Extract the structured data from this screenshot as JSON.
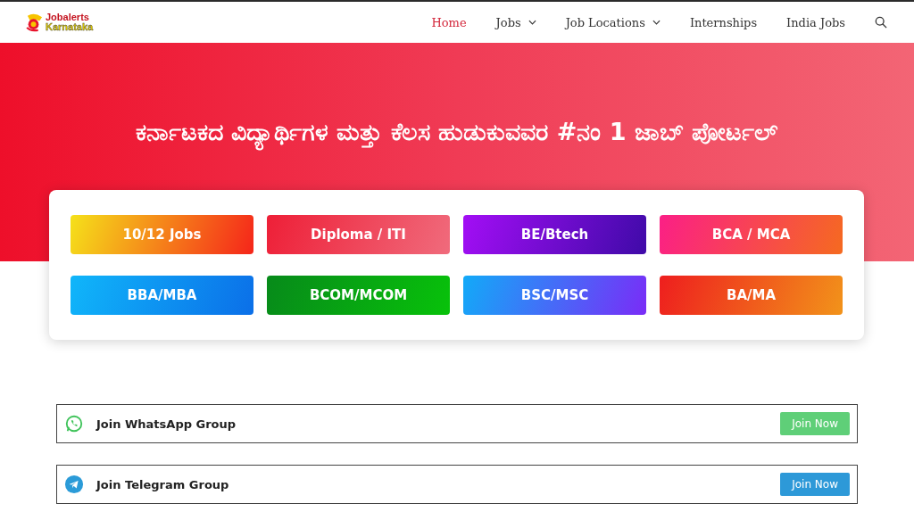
{
  "logo": {
    "line_1": "Jobalerts",
    "line_2": "Karnataka"
  },
  "nav": [
    {
      "label": "Home",
      "selected": true,
      "dropdown": false
    },
    {
      "label": "Jobs",
      "selected": false,
      "dropdown": true
    },
    {
      "label": "Job Locations",
      "selected": false,
      "dropdown": true
    },
    {
      "label": "Internships",
      "selected": false,
      "dropdown": false
    },
    {
      "label": "India Jobs",
      "selected": false,
      "dropdown": false
    }
  ],
  "hero": {
    "title": "ಕರ್ನಾಟಕದ ವಿದ್ಯಾರ್ಥಿಗಳ ಮತ್ತು ಕೆಲಸ ಹುಡುಕುವವರ #ನಂ 1 ಜಾಬ್ ಪೋರ್ಟಲ್"
  },
  "categories": [
    {
      "label": "10/12 Jobs"
    },
    {
      "label": "Diploma / ITI"
    },
    {
      "label": "BE/Btech"
    },
    {
      "label": "BCA / MCA"
    },
    {
      "label": "BBA/MBA"
    },
    {
      "label": "BCOM/MCOM"
    },
    {
      "label": "BSC/MSC"
    },
    {
      "label": "BA/MA"
    }
  ],
  "groups": [
    {
      "kind": "whatsapp",
      "label": "Join WhatsApp Group",
      "button": "Join Now"
    },
    {
      "kind": "telegram",
      "label": "Join Telegram Group",
      "button": "Join Now"
    }
  ]
}
